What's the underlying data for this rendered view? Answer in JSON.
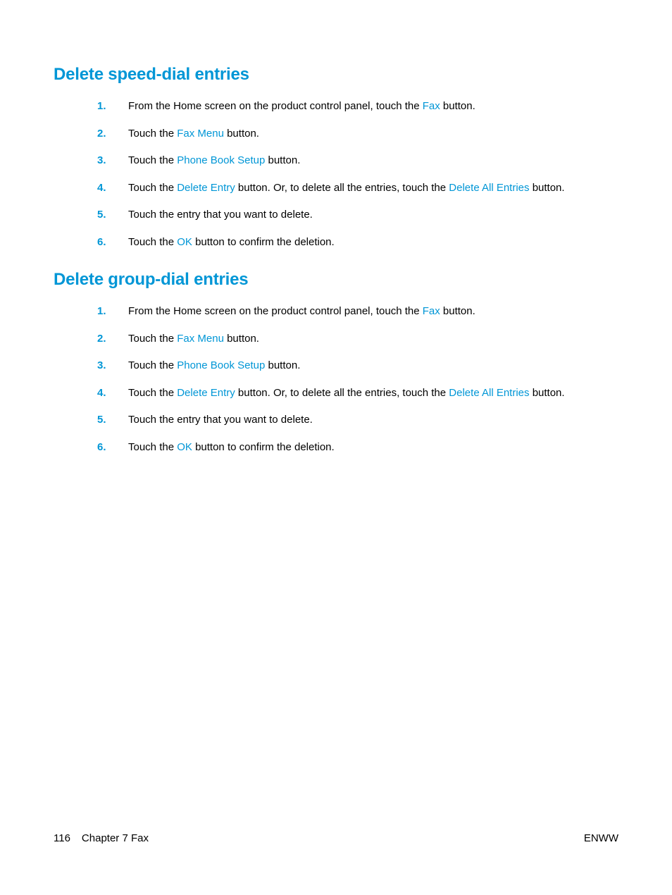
{
  "section1": {
    "heading": "Delete speed-dial entries",
    "steps": {
      "s1": {
        "num": "1.",
        "a": "From the Home screen on the product control panel, touch the ",
        "ui1": "Fax",
        "b": " button."
      },
      "s2": {
        "num": "2.",
        "a": "Touch the ",
        "ui1": "Fax Menu",
        "b": " button."
      },
      "s3": {
        "num": "3.",
        "a": "Touch the ",
        "ui1": "Phone Book Setup",
        "b": " button."
      },
      "s4": {
        "num": "4.",
        "a": "Touch the ",
        "ui1": "Delete Entry",
        "b": " button. Or, to delete all the entries, touch the ",
        "ui2": "Delete All Entries",
        "c": " button."
      },
      "s5": {
        "num": "5.",
        "a": "Touch the entry that you want to delete."
      },
      "s6": {
        "num": "6.",
        "a": "Touch the ",
        "ui1": "OK",
        "b": " button to confirm the deletion."
      }
    }
  },
  "section2": {
    "heading": "Delete group-dial entries",
    "steps": {
      "s1": {
        "num": "1.",
        "a": "From the Home screen on the product control panel, touch the ",
        "ui1": "Fax",
        "b": " button."
      },
      "s2": {
        "num": "2.",
        "a": "Touch the ",
        "ui1": "Fax Menu",
        "b": " button."
      },
      "s3": {
        "num": "3.",
        "a": "Touch the ",
        "ui1": "Phone Book Setup",
        "b": " button."
      },
      "s4": {
        "num": "4.",
        "a": "Touch the ",
        "ui1": "Delete Entry",
        "b": " button. Or, to delete all the entries, touch the ",
        "ui2": "Delete All Entries",
        "c": " button."
      },
      "s5": {
        "num": "5.",
        "a": "Touch the entry that you want to delete."
      },
      "s6": {
        "num": "6.",
        "a": "Touch the ",
        "ui1": "OK",
        "b": " button to confirm the deletion."
      }
    }
  },
  "footer": {
    "page": "116",
    "chapter": "Chapter 7   Fax",
    "right": "ENWW"
  }
}
